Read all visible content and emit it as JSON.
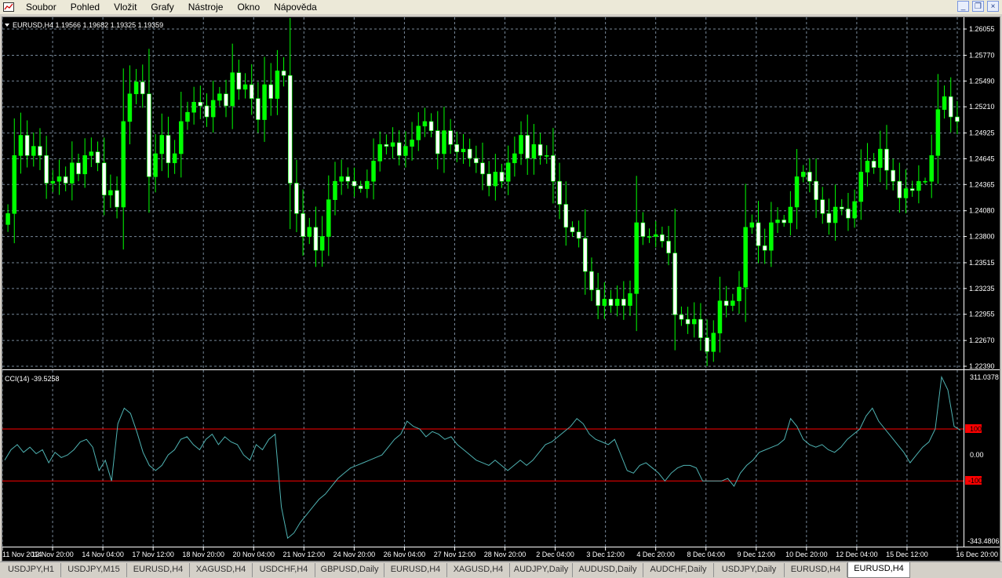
{
  "menu": [
    "Soubor",
    "Pohled",
    "Vložit",
    "Grafy",
    "Nástroje",
    "Okno",
    "Nápověda"
  ],
  "window_controls": {
    "minimize": "_",
    "restore": "❐",
    "close": "×"
  },
  "main_chart": {
    "header": "EURUSD,H4  1.19566 1.19682 1.19325 1.19359",
    "price_labels": [
      "1.26055",
      "1.25770",
      "1.25490",
      "1.25210",
      "1.24925",
      "1.24645",
      "1.24365",
      "1.24080",
      "1.23800",
      "1.23515",
      "1.23235",
      "1.22955",
      "1.22670",
      "1.22390"
    ]
  },
  "indicator": {
    "header": "CCI(14) -39.5258",
    "labels": {
      "top": "311.0378",
      "plus100": "100",
      "zero": "0.00",
      "minus100": "-100",
      "bottom": "-343.4806"
    }
  },
  "time_labels": [
    "11 Nov 2014",
    "12 Nov 20:00",
    "14 Nov 04:00",
    "17 Nov 12:00",
    "18 Nov 20:00",
    "20 Nov 04:00",
    "21 Nov 12:00",
    "24 Nov 20:00",
    "26 Nov 04:00",
    "27 Nov 12:00",
    "28 Nov 20:00",
    "2 Dec 04:00",
    "3 Dec 12:00",
    "4 Dec 20:00",
    "8 Dec 04:00",
    "9 Dec 12:00",
    "10 Dec 20:00",
    "12 Dec 04:00",
    "15 Dec 12:00",
    "16 Dec 20:00"
  ],
  "tabs": [
    "USDJPY,H1",
    "USDJPY,M15",
    "EURUSD,H4",
    "XAGUSD,H4",
    "USDCHF,H4",
    "GBPUSD,Daily",
    "EURUSD,H4",
    "XAGUSD,H4",
    "AUDJPY,Daily",
    "AUDUSD,Daily",
    "AUDCHF,Daily",
    "USDJPY,Daily",
    "EURUSD,H4",
    "EURUSD,H4"
  ],
  "active_tab": 13,
  "colors": {
    "background": "#000000",
    "grid": "#778899",
    "bull_candle": "#ffffff",
    "bear_candle": "#00ff00",
    "wick": "#00ff00",
    "cci_line": "#4fb3b3",
    "cci_levels": "#ff0000",
    "axis_text": "#ffffff"
  },
  "chart_data": [
    {
      "type": "candlestick",
      "symbol": "EURUSD",
      "timeframe": "H4",
      "ylim": [
        1.2239,
        1.26055
      ],
      "grid": true,
      "closes": [
        1.2405,
        1.2468,
        1.249,
        1.2468,
        1.2478,
        1.2468,
        1.2438,
        1.244,
        1.2445,
        1.2438,
        1.246,
        1.2448,
        1.2468,
        1.2472,
        1.246,
        1.2425,
        1.243,
        1.2412,
        1.2505,
        1.2535,
        1.2548,
        1.2535,
        1.2445,
        1.247,
        1.249,
        1.246,
        1.247,
        1.2505,
        1.2515,
        1.2526,
        1.2522,
        1.251,
        1.2528,
        1.2535,
        1.2522,
        1.2558,
        1.254,
        1.2545,
        1.253,
        1.2507,
        1.2545,
        1.253,
        1.256,
        1.2555,
        1.2438,
        1.2405,
        1.238,
        1.239,
        1.2365,
        1.238,
        1.242,
        1.244,
        1.2445,
        1.244,
        1.2435,
        1.2432,
        1.244,
        1.2462,
        1.248,
        1.2478,
        1.2482,
        1.2468,
        1.2478,
        1.2485,
        1.25,
        1.2505,
        1.2495,
        1.247,
        1.2495,
        1.248,
        1.2472,
        1.2475,
        1.2465,
        1.246,
        1.2448,
        1.2435,
        1.245,
        1.244,
        1.246,
        1.247,
        1.249,
        1.2465,
        1.248,
        1.2468,
        1.2468,
        1.244,
        1.2415,
        1.239,
        1.2385,
        1.2378,
        1.2342,
        1.2322,
        1.2305,
        1.2312,
        1.2305,
        1.2312,
        1.2305,
        1.2318,
        1.2395,
        1.238,
        1.238,
        1.2382,
        1.2375,
        1.2362,
        1.2295,
        1.229,
        1.2285,
        1.229,
        1.227,
        1.2255,
        1.2275,
        1.231,
        1.2305,
        1.231,
        1.2325,
        1.239,
        1.2395,
        1.237,
        1.2365,
        1.2395,
        1.2398,
        1.2395,
        1.2412,
        1.2445,
        1.245,
        1.244,
        1.242,
        1.2405,
        1.2395,
        1.2412,
        1.241,
        1.24,
        1.2418,
        1.245,
        1.2462,
        1.2455,
        1.2475,
        1.2452,
        1.244,
        1.2422,
        1.2432,
        1.243,
        1.244,
        1.244,
        1.2468,
        1.2518,
        1.2532,
        1.251,
        1.2505
      ]
    },
    {
      "type": "line",
      "indicator": "CCI(14)",
      "ylim": [
        -343.4806,
        311.0378
      ],
      "levels": [
        100,
        -100
      ],
      "values": [
        -20,
        20,
        40,
        10,
        30,
        5,
        20,
        -30,
        10,
        -10,
        0,
        20,
        50,
        60,
        30,
        -60,
        -20,
        -100,
        120,
        180,
        160,
        90,
        10,
        -40,
        -60,
        -40,
        0,
        20,
        60,
        70,
        40,
        20,
        60,
        80,
        40,
        70,
        50,
        40,
        0,
        -20,
        40,
        20,
        60,
        80,
        -200,
        -320,
        -300,
        -260,
        -230,
        -200,
        -170,
        -150,
        -120,
        -90,
        -70,
        -50,
        -40,
        -30,
        -20,
        -10,
        0,
        30,
        60,
        80,
        130,
        110,
        100,
        70,
        90,
        80,
        60,
        70,
        40,
        20,
        0,
        -20,
        -30,
        -40,
        -20,
        -40,
        -60,
        -40,
        -20,
        -40,
        -20,
        10,
        40,
        50,
        70,
        90,
        110,
        140,
        120,
        80,
        60,
        50,
        40,
        60,
        0,
        -60,
        -70,
        -40,
        -30,
        -50,
        -70,
        -100,
        -70,
        -50,
        -40,
        -40,
        -50,
        -100,
        -100,
        -100,
        -100,
        -90,
        -120,
        -70,
        -40,
        -20,
        10,
        20,
        30,
        40,
        60,
        140,
        110,
        60,
        40,
        30,
        40,
        20,
        10,
        30,
        60,
        80,
        100,
        150,
        180,
        130,
        100,
        70,
        40,
        10,
        -30,
        0,
        30,
        50,
        100,
        300,
        250,
        110,
        95
      ]
    }
  ]
}
